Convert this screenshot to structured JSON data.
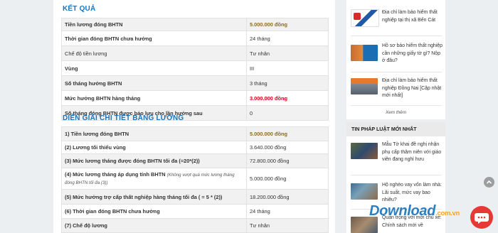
{
  "results": {
    "title": "KẾT QUẢ",
    "rows": [
      {
        "label": "Tiền lương đóng BHTN",
        "value": "5.000.000 đồng",
        "style": "gold"
      },
      {
        "label": "Thời gian đóng BHTN chưa hưởng",
        "value": "24 tháng"
      },
      {
        "label": "Chế độ tiền lương",
        "value": "Tư nhân"
      },
      {
        "label": "Vùng",
        "value": "III"
      },
      {
        "label": "Số tháng hưởng BHTN",
        "value": "3 tháng"
      },
      {
        "label": "Mức hưởng BHTN hàng tháng",
        "value": "3.000.000 đồng",
        "style": "red"
      },
      {
        "label": "Số tháng đóng BHTN được bảo lưu cho lần hưởng sau",
        "value": "0"
      }
    ]
  },
  "details": {
    "title": "DIỄN GIẢI CHI TIẾT BẢNG LƯƠNG",
    "rows": [
      {
        "label": "1) Tiền lương đóng BHTN",
        "value": "5.000.000 đồng",
        "style": "gold"
      },
      {
        "label": "(2) Lương tối thiểu vùng",
        "value": "3.640.000 đồng"
      },
      {
        "label": "(3) Mức lương tháng được đóng BHTN tối đa (=20*(2))",
        "value": "72.800.000 đồng"
      },
      {
        "label": "(4) Mức lương tháng áp dụng tính BHTN",
        "note": "(Không vượt quá mức lương tháng đóng BHTN tối đa (3))",
        "value": "5.000.000 đồng"
      },
      {
        "label": "(5) Mức hưởng trợ cấp thất nghiệp hàng tháng tối đa ( = 5 * (2))",
        "value": "18.200.000 đồng"
      },
      {
        "label": "(6) Thời gian đóng BHTN chưa hưởng",
        "value": "24 tháng"
      },
      {
        "label": "(7) Chế độ lương",
        "value": "Tư nhân"
      }
    ]
  },
  "sidebar": {
    "related": [
      {
        "text": "Địa chỉ làm bảo hiểm thất nghiệp tại thị xã Bến Cát"
      },
      {
        "text": "Hồ sơ bảo hiểm thất nghiệp cần những giấy tờ gì? Nộp ở đâu?"
      },
      {
        "text": "Địa chỉ làm bảo hiểm thất nghiệp Đồng Nai [Cập nhật mới nhất]"
      }
    ],
    "see_more": "Xem thêm",
    "news_header": "TIN PHÁP LUẬT MỚI NHẤT",
    "news": [
      {
        "text": "Mẫu Tờ khai đề nghị nhận phụ cấp thâm niên với giáo viên đang nghỉ hưu"
      },
      {
        "text": "Hộ nghèo vay vốn làm nhà: Lãi suất, mức vay bao nhiêu?"
      },
      {
        "text": "Quan trọng với mới chủ xe: Chính sách mới về"
      }
    ]
  },
  "watermark": {
    "text": "Download",
    "tld": ".com.vn"
  },
  "colors": {
    "accent": "#1b75bc",
    "gold": "#8b6a2c",
    "red": "#d0021b",
    "chat": "#e53935"
  }
}
